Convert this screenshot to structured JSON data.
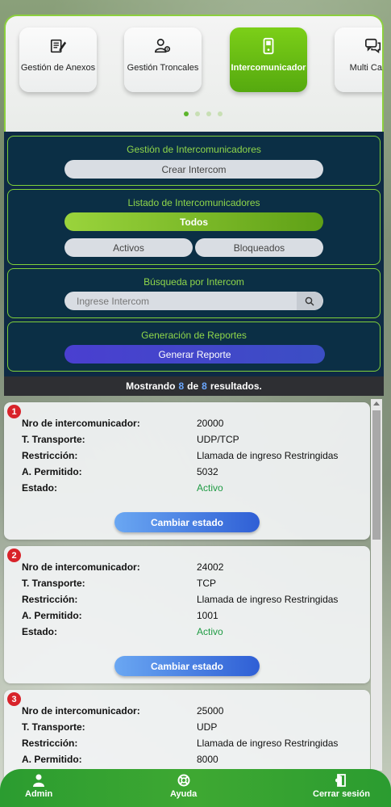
{
  "tiles": [
    {
      "label": "Gestión de Anexos",
      "icon": "document-edit-icon"
    },
    {
      "label": "Gestión Troncales",
      "icon": "user-settings-icon"
    },
    {
      "label": "Intercomunicador",
      "icon": "intercom-device-icon"
    },
    {
      "label": "Multi Call Ri",
      "icon": "chat-bubbles-icon"
    }
  ],
  "sections": {
    "gestion": {
      "title": "Gestión de Intercomunicadores",
      "create_label": "Crear Intercom"
    },
    "listado": {
      "title": "Listado de Intercomunicadores",
      "all_label": "Todos",
      "active_label": "Activos",
      "blocked_label": "Bloqueados"
    },
    "busqueda": {
      "title": "Búsqueda por Intercom",
      "placeholder": "Ingrese Intercom"
    },
    "reportes": {
      "title": "Generación de Reportes",
      "generate_label": "Generar Reporte"
    }
  },
  "results": {
    "prefix": "Mostrando",
    "shown": "8",
    "of": "de",
    "total": "8",
    "suffix": "resultados."
  },
  "labels": {
    "number": "Nro de intercomunicador:",
    "transport": "T. Transporte:",
    "restriction": "Restricción:",
    "allowed": "A. Permitido:",
    "status": "Estado:",
    "change_status": "Cambiar estado"
  },
  "records": [
    {
      "index": "1",
      "number": "20000",
      "transport": "UDP/TCP",
      "restriction": "Llamada de ingreso Restringidas",
      "allowed": "5032",
      "status": "Activo"
    },
    {
      "index": "2",
      "number": "24002",
      "transport": "TCP",
      "restriction": "Llamada de ingreso Restringidas",
      "allowed": "1001",
      "status": "Activo"
    },
    {
      "index": "3",
      "number": "25000",
      "transport": "UDP",
      "restriction": "Llamada de ingreso Restringidas",
      "allowed": "8000"
    }
  ],
  "nav": {
    "admin": "Admin",
    "help": "Ayuda",
    "logout": "Cerrar sesión"
  },
  "colors": {
    "accent_green": "#7ccf18",
    "panel_dark": "#0e2a44",
    "badge_red": "#d8232a",
    "status_active": "#1f9b44",
    "button_blue": "#2f5fd5"
  }
}
